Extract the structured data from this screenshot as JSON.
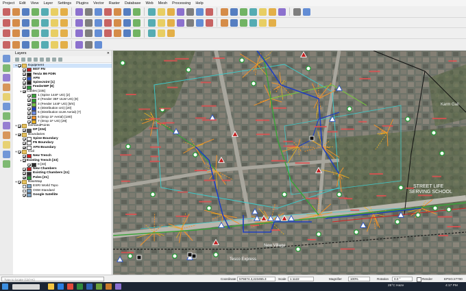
{
  "menu": [
    "Project",
    "Edit",
    "View",
    "Layer",
    "Settings",
    "Plugins",
    "Vector",
    "Raster",
    "Database",
    "Web",
    "Mesh",
    "Processing",
    "Help"
  ],
  "toolbar_icons": {
    "row1": [
      "new-project-icon",
      "open-project-icon",
      "save-project-icon",
      "save-as-icon",
      "print-layout-icon",
      "layout-manager-icon",
      "style-manager-icon",
      "pan-map-icon",
      "pan-to-selection-icon",
      "zoom-in-icon",
      "zoom-out-icon",
      "zoom-full-icon",
      "zoom-selection-icon",
      "zoom-layer-icon",
      "zoom-last-icon",
      "zoom-next-icon",
      "new-bookmark-icon",
      "show-bookmarks-icon",
      "refresh-icon",
      "identify-icon",
      "select-features-icon",
      "select-value-icon",
      "deselect-icon",
      "field-calculator-icon",
      "statistics-icon",
      "measure-icon",
      "annotation-icon",
      "text-annotation-icon",
      "map-tips-icon",
      "label-icon"
    ],
    "row2": [
      "data-source-manager-icon",
      "new-geopackage-icon",
      "new-shapefile-icon",
      "new-spatialite-icon",
      "new-temp-layer-icon",
      "add-vector-icon",
      "add-raster-icon",
      "add-delimited-icon",
      "add-postgis-icon",
      "add-wms-icon",
      "current-edits-icon",
      "toggle-editing-icon",
      "save-edits-icon",
      "digitize-icon",
      "vertex-tool-icon",
      "delete-icon",
      "cut-icon",
      "copy-icon",
      "paste-icon",
      "undo-icon",
      "redo-icon",
      "plugin-a-icon",
      "plugin-b-icon",
      "python-console-icon",
      "plugin-c-icon",
      "plugin-d-icon",
      "plugin-e-icon"
    ],
    "row3": [
      "python-icon",
      "layer-style-icon",
      "polygon-icon",
      "line-icon",
      "point-icon",
      "fill-ring-icon",
      "reshape-icon",
      "offset-curve-icon",
      "split-icon",
      "merge-icon",
      "rotate-icon",
      "simplify-icon",
      "snap-icon",
      "trace-icon",
      "topology-icon",
      "advanced-edit-icon",
      "measure-angle-icon"
    ],
    "row4": [
      "refresh-map-icon",
      "temporal-icon",
      "node-tool-icon",
      "circle-icon",
      "arc-icon",
      "ellipse-icon",
      "rectangle-icon",
      "regular-polygon-icon",
      "tracing-icon",
      "shape-digitize-icon"
    ]
  },
  "layers_panel": {
    "title": "Layers",
    "items": [
      {
        "label": "Equipment",
        "level": 0,
        "checked": true,
        "expander": "▾",
        "symbol": "group",
        "bold": false,
        "selected": true
      },
      {
        "label": "MST FN",
        "level": 1,
        "checked": true,
        "expander": "",
        "symbol": "#c21f1f",
        "bold": true,
        "selected": false
      },
      {
        "label": "Tenáx B6 FDIN",
        "level": 1,
        "checked": true,
        "expander": "",
        "symbol": "#222222",
        "bold": true,
        "selected": false
      },
      {
        "label": "AFN",
        "level": 1,
        "checked": true,
        "expander": "",
        "symbol": "#2b55c7",
        "bold": true,
        "selected": false
      },
      {
        "label": "SpineJoint [1]",
        "level": 1,
        "checked": true,
        "expander": "",
        "symbol": "#222222",
        "bold": true,
        "selected": false
      },
      {
        "label": "FeederWP [8]",
        "level": 1,
        "checked": true,
        "expander": "",
        "symbol": "#2b9a3a",
        "bold": true,
        "selected": false
      },
      {
        "label": "Cables [235]",
        "level": 1,
        "checked": true,
        "expander": "▾",
        "symbol": "",
        "bold": false,
        "selected": false
      },
      {
        "label": "1 (Spine 144F UG) [2]",
        "level": 2,
        "checked": true,
        "expander": "",
        "symbol": "#3aa33a",
        "bold": false,
        "selected": false
      },
      {
        "label": "2 (Feeder 36F ULW UG) [9]",
        "level": 2,
        "checked": true,
        "expander": "",
        "symbol": "#2f9a2f",
        "bold": false,
        "selected": false
      },
      {
        "label": "3 (Feeder 144F UG) [9/4]",
        "level": 2,
        "checked": true,
        "expander": "",
        "symbol": "#76c043",
        "bold": false,
        "selected": false
      },
      {
        "label": "4 (Distribution UG) [20]",
        "level": 2,
        "checked": true,
        "expander": "",
        "symbol": "#1f3fbf",
        "bold": false,
        "selected": false
      },
      {
        "label": "5 (Distribution ULW Aerial) [7]",
        "level": 2,
        "checked": true,
        "expander": "",
        "symbol": "#6e8be0",
        "bold": false,
        "selected": false
      },
      {
        "label": "6 (Drop 1F Aerial) [180]",
        "level": 2,
        "checked": true,
        "expander": "",
        "symbol": "#f0922a",
        "bold": false,
        "selected": false
      },
      {
        "label": "7 (Drop 1F UG) [29]",
        "level": 2,
        "checked": true,
        "expander": "",
        "symbol": "#e8b020",
        "bold": false,
        "selected": false
      },
      {
        "label": "DemandPoints",
        "level": 0,
        "checked": true,
        "expander": "▾",
        "symbol": "group",
        "bold": false,
        "selected": false
      },
      {
        "label": "DP [234]",
        "level": 1,
        "checked": true,
        "expander": "",
        "symbol": "#555555",
        "bold": true,
        "selected": false
      },
      {
        "label": "Boundaries",
        "level": 0,
        "checked": true,
        "expander": "▾",
        "symbol": "group",
        "bold": false,
        "selected": false
      },
      {
        "label": "Spine Boundary",
        "level": 1,
        "checked": true,
        "expander": "",
        "symbol": "#ffffff",
        "bold": true,
        "selected": false
      },
      {
        "label": "FN Boundary",
        "level": 1,
        "checked": true,
        "expander": "",
        "symbol": "#ffffff",
        "bold": true,
        "selected": false
      },
      {
        "label": "AFN Boundary",
        "level": 1,
        "checked": true,
        "expander": "",
        "symbol": "#ffffff",
        "bold": true,
        "selected": false
      },
      {
        "label": "Civil",
        "level": 0,
        "checked": true,
        "expander": "▾",
        "symbol": "group",
        "bold": false,
        "selected": false
      },
      {
        "label": "New Trench",
        "level": 1,
        "checked": true,
        "expander": "",
        "symbol": "#d32020",
        "bold": true,
        "selected": false
      },
      {
        "label": "Existing Trench [33]",
        "level": 1,
        "checked": true,
        "expander": "▾",
        "symbol": "",
        "bold": true,
        "selected": false
      },
      {
        "label": "0 [33]",
        "level": 2,
        "checked": true,
        "expander": "",
        "symbol": "#2a2a2a",
        "bold": false,
        "selected": false
      },
      {
        "label": "New Chambers",
        "level": 1,
        "checked": true,
        "expander": "",
        "symbol": "#c21f1f",
        "bold": true,
        "selected": false
      },
      {
        "label": "Existing Chambers [11]",
        "level": 1,
        "checked": true,
        "expander": "",
        "symbol": "#333333",
        "bold": true,
        "selected": false
      },
      {
        "label": "Poles [21]",
        "level": 1,
        "checked": true,
        "expander": "",
        "symbol": "#2b9a3a",
        "bold": true,
        "selected": false
      },
      {
        "label": "BaseMap",
        "level": 0,
        "checked": true,
        "expander": "▾",
        "symbol": "group",
        "bold": false,
        "selected": false
      },
      {
        "label": "ESRI World Topo",
        "level": 1,
        "checked": false,
        "expander": "",
        "symbol": "#7ea6c9",
        "bold": false,
        "selected": false
      },
      {
        "label": "OSM Standard",
        "level": 1,
        "checked": false,
        "expander": "",
        "symbol": "#7ea6c9",
        "bold": false,
        "selected": false
      },
      {
        "label": "Google Satellite",
        "level": 1,
        "checked": true,
        "expander": "",
        "symbol": "#7ea6c9",
        "bold": true,
        "selected": false
      }
    ]
  },
  "map_labels": [
    "STREET LIFE",
    "SERVING SCHOOL",
    "Karm Gall",
    "Tesco Express",
    "New Village"
  ],
  "map_colors": {
    "drop": "#f0922a",
    "distribution": "#1f3fbf",
    "feeder": "#3aa33a",
    "boundary": "#3ec8c8",
    "dp_label": "#e05050",
    "trench": "#1a1a1a"
  },
  "statusbar": {
    "locate_placeholder": "Type to locate (Ctrl+K)",
    "coordinate_label": "Coordinate",
    "coordinate_value": "576674.3,223455.3",
    "scale_label": "Scale",
    "scale_value": "1:1122",
    "magnifier_label": "Magnifier",
    "magnifier_value": "100%",
    "rotation_label": "Rotation",
    "rotation_value": "0.0 °",
    "render_label": "Render",
    "crs_label": "EPSG:27700"
  },
  "taskbar": {
    "weather": "25°C  Haze",
    "time": "4:17 PM"
  }
}
